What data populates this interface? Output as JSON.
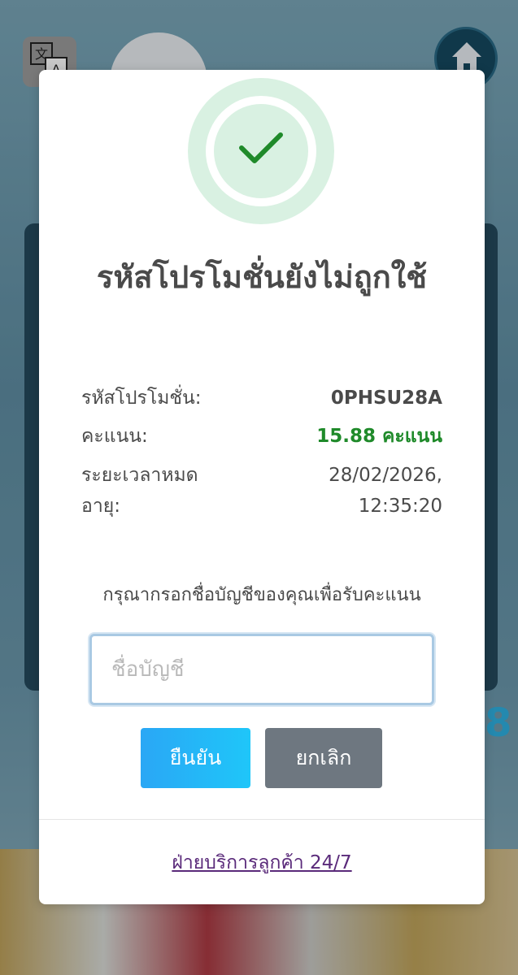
{
  "colors": {
    "success_green": "#1f8a2a",
    "success_ring": "#d9f1e2",
    "confirm_button": "#2aa7f5",
    "cancel_button": "#6e7780",
    "link": "#5a2a7a"
  },
  "background": {
    "translate_icon": "translate-icon",
    "home_icon": "home-icon",
    "partial_digit": "8"
  },
  "modal": {
    "status_icon": "check-icon",
    "title": "รหัสโปรโมชั่นยังไม่ถูกใช้",
    "details": {
      "code_label": "รหัสโปรโมชั่น:",
      "code_value": "0PHSU28A",
      "points_label": "คะแนน:",
      "points_value": "15.88 คะแนน",
      "expiry_label": "ระยะเวลาหมดอายุ:",
      "expiry_value": "28/02/2026, 12:35:20"
    },
    "prompt": "กรุณากรอกชื่อบัญชีของคุณเพื่อรับคะแนน",
    "account_input": {
      "placeholder": "ชื่อบัญชี",
      "value": ""
    },
    "buttons": {
      "confirm_label": "ยืนยัน",
      "cancel_label": "ยกเลิก"
    },
    "support_link": "ฝ่ายบริการลูกค้า 24/7"
  }
}
